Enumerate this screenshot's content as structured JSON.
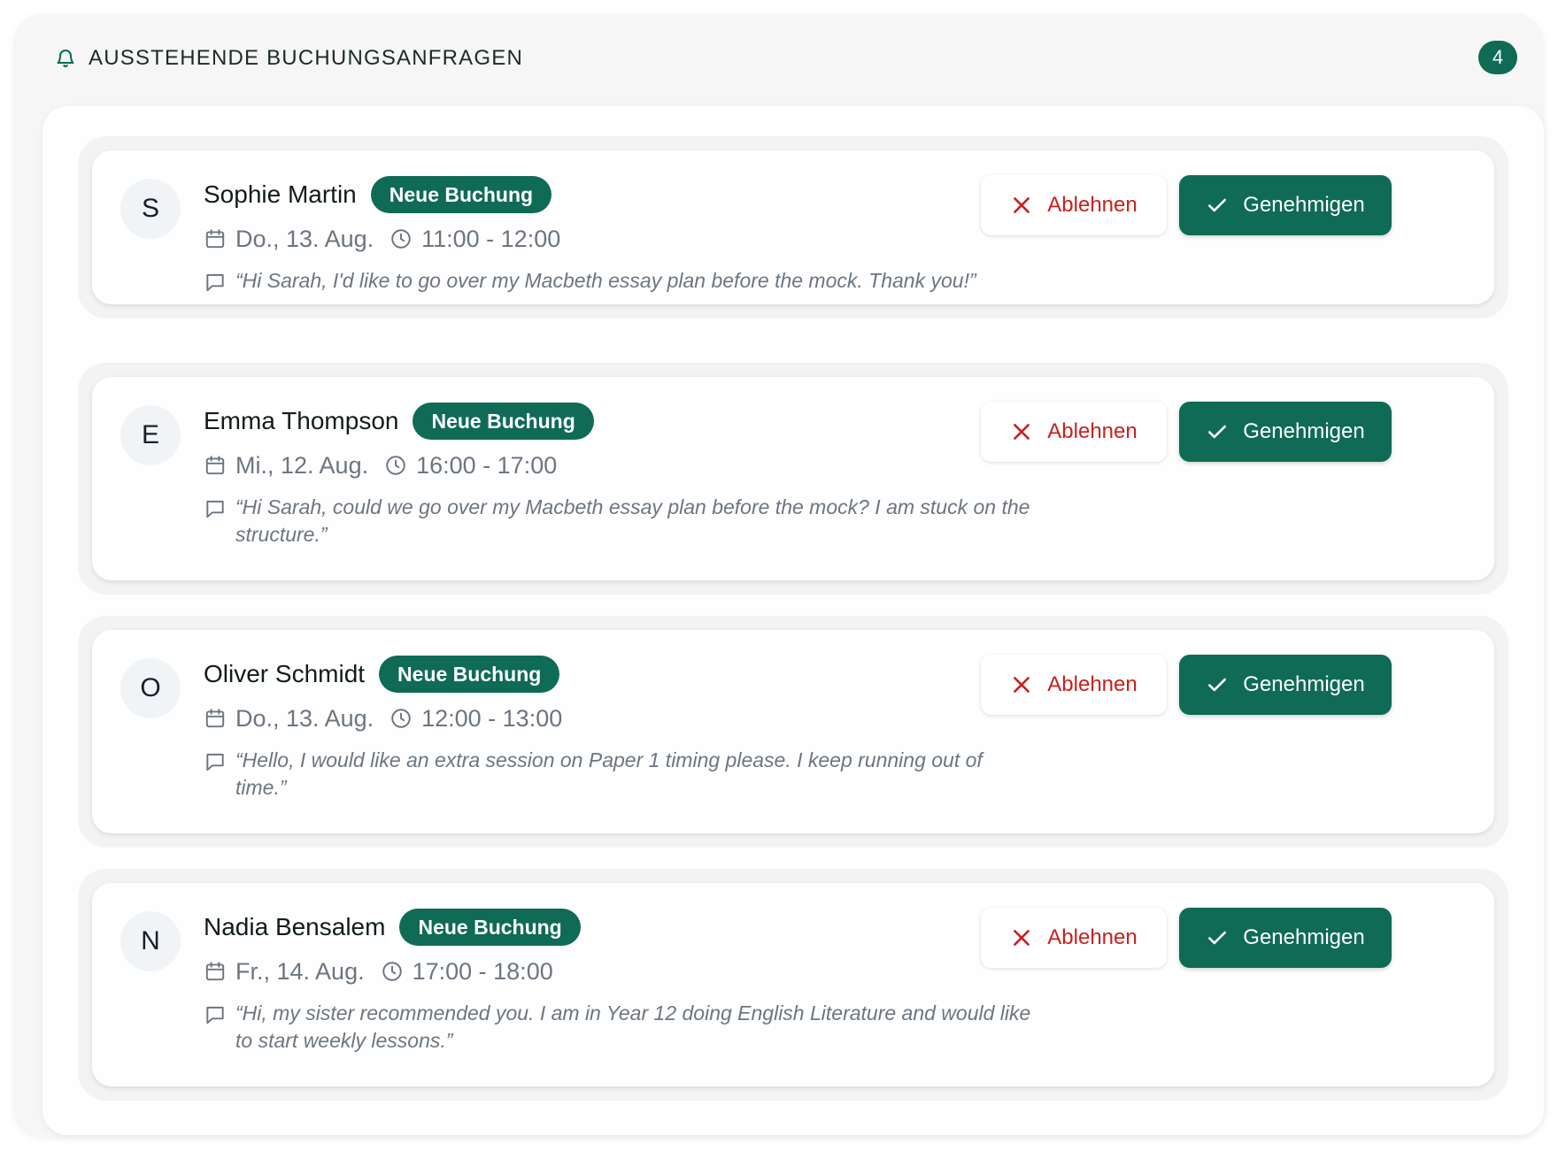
{
  "header": {
    "title": "AUSSTEHENDE BUCHUNGSANFRAGEN",
    "icon": "bell-icon",
    "count": "4"
  },
  "colors": {
    "accent": "#0f6b55",
    "decline": "#c8201e",
    "muted_text": "#6c7680"
  },
  "requests": [
    {
      "initial": "S",
      "name": "Sophie Martin",
      "tag": "Neue Buchung",
      "date": "Do., 13. Aug.",
      "time": "11:00 - 12:00",
      "message": "“Hi Sarah, I'd like to go over my Macbeth essay plan before the mock. Thank you!”",
      "decline_label": "Ablehnen",
      "approve_label": "Genehmigen"
    },
    {
      "initial": "E",
      "name": "Emma Thompson",
      "tag": "Neue Buchung",
      "date": "Mi., 12. Aug.",
      "time": "16:00 - 17:00",
      "message": "“Hi Sarah, could we go over my Macbeth essay plan before the mock? I am stuck on the structure.”",
      "decline_label": "Ablehnen",
      "approve_label": "Genehmigen"
    },
    {
      "initial": "O",
      "name": "Oliver Schmidt",
      "tag": "Neue Buchung",
      "date": "Do., 13. Aug.",
      "time": "12:00 - 13:00",
      "message": "“Hello, I would like an extra session on Paper 1 timing please. I keep running out of time.”",
      "decline_label": "Ablehnen",
      "approve_label": "Genehmigen"
    },
    {
      "initial": "N",
      "name": "Nadia Bensalem",
      "tag": "Neue Buchung",
      "date": "Fr., 14. Aug.",
      "time": "17:00 - 18:00",
      "message": "“Hi, my sister recommended you. I am in Year 12 doing English Literature and would like to start weekly lessons.”",
      "decline_label": "Ablehnen",
      "approve_label": "Genehmigen"
    }
  ]
}
